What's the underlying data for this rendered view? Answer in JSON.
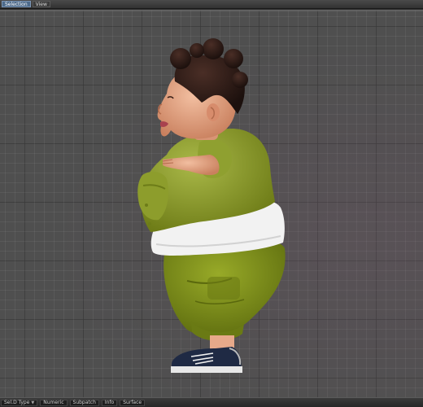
{
  "toolbar": {
    "tabs": [
      {
        "label": "Selection",
        "active": true
      },
      {
        "label": "View",
        "active": false
      }
    ]
  },
  "viewport": {
    "content": "character-model-side-view",
    "colors": {
      "background": "#4f4f4f",
      "grid_major": "#2f2f2f",
      "shirt": "#8a9a2a",
      "undershirt": "#f2f2f2",
      "pants": "#7b8c1c",
      "hair": "#2b1a16",
      "skin": "#e4a181",
      "shoe": "#1f2a44",
      "shoe_sole": "#e8e8e8"
    }
  },
  "statusbar": {
    "items": [
      {
        "label": "Sel.D Type",
        "has_dropdown": true
      },
      {
        "label": "Numeric",
        "has_dropdown": false
      },
      {
        "label": "Subpatch",
        "has_dropdown": false
      },
      {
        "label": "Info",
        "has_dropdown": false
      },
      {
        "label": "Surface",
        "has_dropdown": false
      }
    ]
  }
}
